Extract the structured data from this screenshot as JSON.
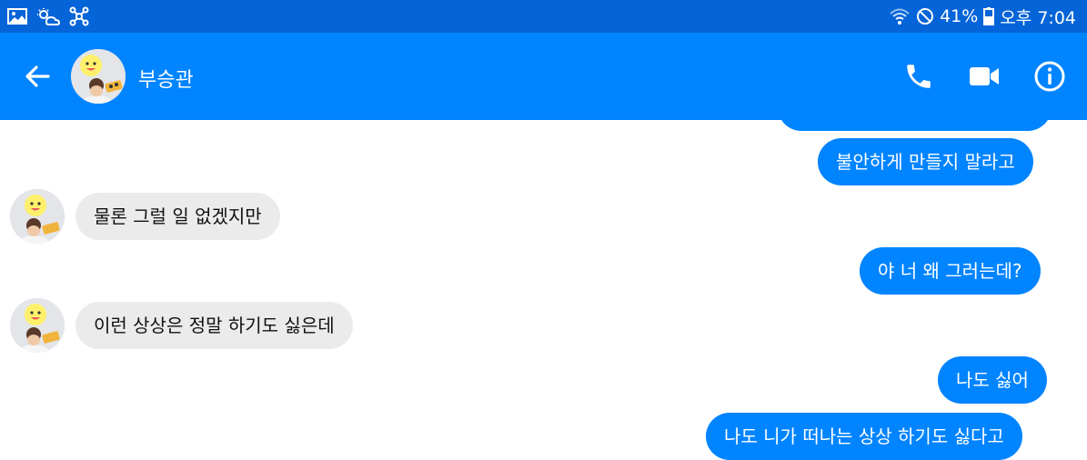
{
  "status_bar": {
    "battery_percent": "41%",
    "time": "오후 7:04"
  },
  "header": {
    "contact_name": "부승관"
  },
  "colors": {
    "status_bar": "#0464d8",
    "header": "#0084ff",
    "outgoing_bubble": "#0084ff",
    "incoming_bubble": "#ebebeb"
  },
  "messages": [
    {
      "direction": "out",
      "text": ""
    },
    {
      "direction": "out",
      "text": "불안하게 만들지 말라고"
    },
    {
      "direction": "in",
      "text": "물론 그럴 일 없겠지만"
    },
    {
      "direction": "out",
      "text": "야 너 왜 그러는데?"
    },
    {
      "direction": "in",
      "text": "이런 상상은 정말 하기도 싫은데"
    },
    {
      "direction": "out",
      "text": "나도 싫어"
    },
    {
      "direction": "out",
      "text": "나도 니가 떠나는 상상 하기도 싫다고"
    }
  ]
}
